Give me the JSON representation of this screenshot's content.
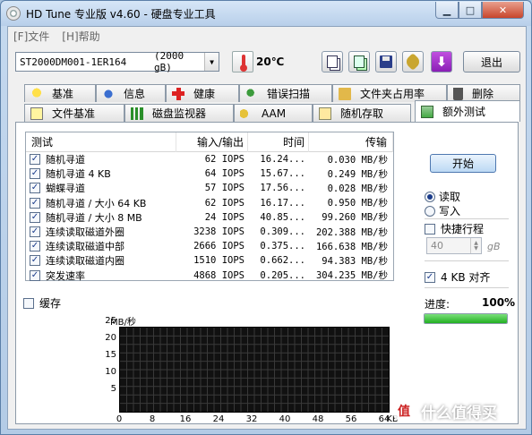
{
  "window": {
    "title": "HD Tune 专业版 v4.60 - 硬盘专业工具"
  },
  "menu": {
    "file": "[F]文件",
    "help": "[H]帮助"
  },
  "toolbar": {
    "drive_name": "ST2000DM001-1ER164",
    "drive_capacity": "(2000 gB)",
    "temperature": "20℃",
    "exit_label": "退出"
  },
  "tabs_row1": [
    "基准",
    "信息",
    "健康",
    "错误扫描",
    "文件夹占用率",
    "删除"
  ],
  "tabs_row2": [
    "文件基准",
    "磁盘监视器",
    "AAM",
    "随机存取",
    "额外测试"
  ],
  "results": {
    "headers": {
      "test": "测试",
      "io": "输入/输出",
      "time": "时间",
      "transfer": "传输"
    },
    "rows": [
      {
        "name": "随机寻道",
        "io": "62 IOPS",
        "time": "16.24...",
        "transfer": "0.030 MB/秒"
      },
      {
        "name": "随机寻道 4 KB",
        "io": "64 IOPS",
        "time": "15.67...",
        "transfer": "0.249 MB/秒"
      },
      {
        "name": "蝴蝶寻道",
        "io": "57 IOPS",
        "time": "17.56...",
        "transfer": "0.028 MB/秒"
      },
      {
        "name": "随机寻道 / 大小 64 KB",
        "io": "62 IOPS",
        "time": "16.17...",
        "transfer": "0.950 MB/秒"
      },
      {
        "name": "随机寻道 / 大小 8 MB",
        "io": "24 IOPS",
        "time": "40.85...",
        "transfer": "99.260 MB/秒"
      },
      {
        "name": "连续读取磁道外圈",
        "io": "3238 IOPS",
        "time": "0.309...",
        "transfer": "202.388 MB/秒"
      },
      {
        "name": "连续读取磁道中部",
        "io": "2666 IOPS",
        "time": "0.375...",
        "transfer": "166.638 MB/秒"
      },
      {
        "name": "连续读取磁道内圈",
        "io": "1510 IOPS",
        "time": "0.662...",
        "transfer": "94.383 MB/秒"
      },
      {
        "name": "突发速率",
        "io": "4868 IOPS",
        "time": "0.205...",
        "transfer": "304.235 MB/秒"
      }
    ]
  },
  "cache_label": "缓存",
  "controls": {
    "start_label": "开始",
    "read_label": "读取",
    "write_label": "写入",
    "short_stroke_label": "快捷行程",
    "short_stroke_value": "40",
    "short_stroke_unit": "gB",
    "align_label": "4 KB 对齐",
    "progress_label": "进度:",
    "progress_value": "100%",
    "progress_fraction": 1.0
  },
  "chart": {
    "ylabel": "MB/秒",
    "yticks": [
      "25",
      "20",
      "15",
      "10",
      "5"
    ],
    "xticks": [
      "0",
      "8",
      "16",
      "24",
      "32",
      "40",
      "48",
      "56",
      "64"
    ],
    "x_unit_suffix": "KB"
  },
  "watermark": {
    "logo": "值",
    "text": "什么值得买"
  }
}
